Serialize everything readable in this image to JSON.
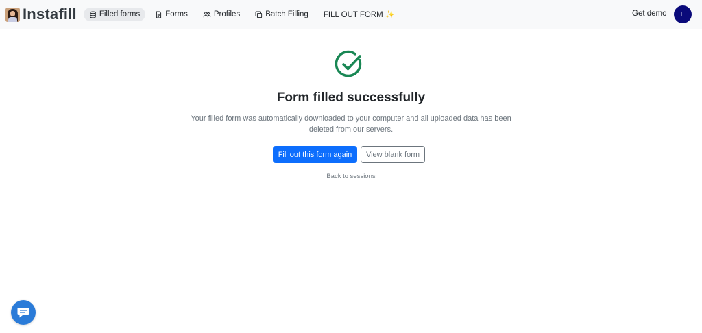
{
  "brand": {
    "name": "Instafill"
  },
  "nav": {
    "items": [
      {
        "label": "Filled forms"
      },
      {
        "label": "Forms"
      },
      {
        "label": "Profiles"
      },
      {
        "label": "Batch Filling"
      },
      {
        "label": "FILL OUT FORM ✨"
      }
    ],
    "get_demo": "Get demo",
    "avatar_initial": "E"
  },
  "main": {
    "title": "Form filled successfully",
    "description": "Your filled form was automatically downloaded to your computer and all uploaded data has been deleted from our servers.",
    "primary_button": "Fill out this form again",
    "secondary_button": "View blank form",
    "back_link": "Back to sessions"
  },
  "colors": {
    "success": "#198754",
    "primary": "#0d6efd",
    "avatar": "#0a0a7a",
    "chat": "#2a7bd8"
  },
  "icons": {
    "filled_forms": "database-icon",
    "forms": "document-icon",
    "profiles": "people-icon",
    "batch": "copy-icon",
    "success": "check-circle-icon",
    "chat": "chat-bubble-icon"
  }
}
